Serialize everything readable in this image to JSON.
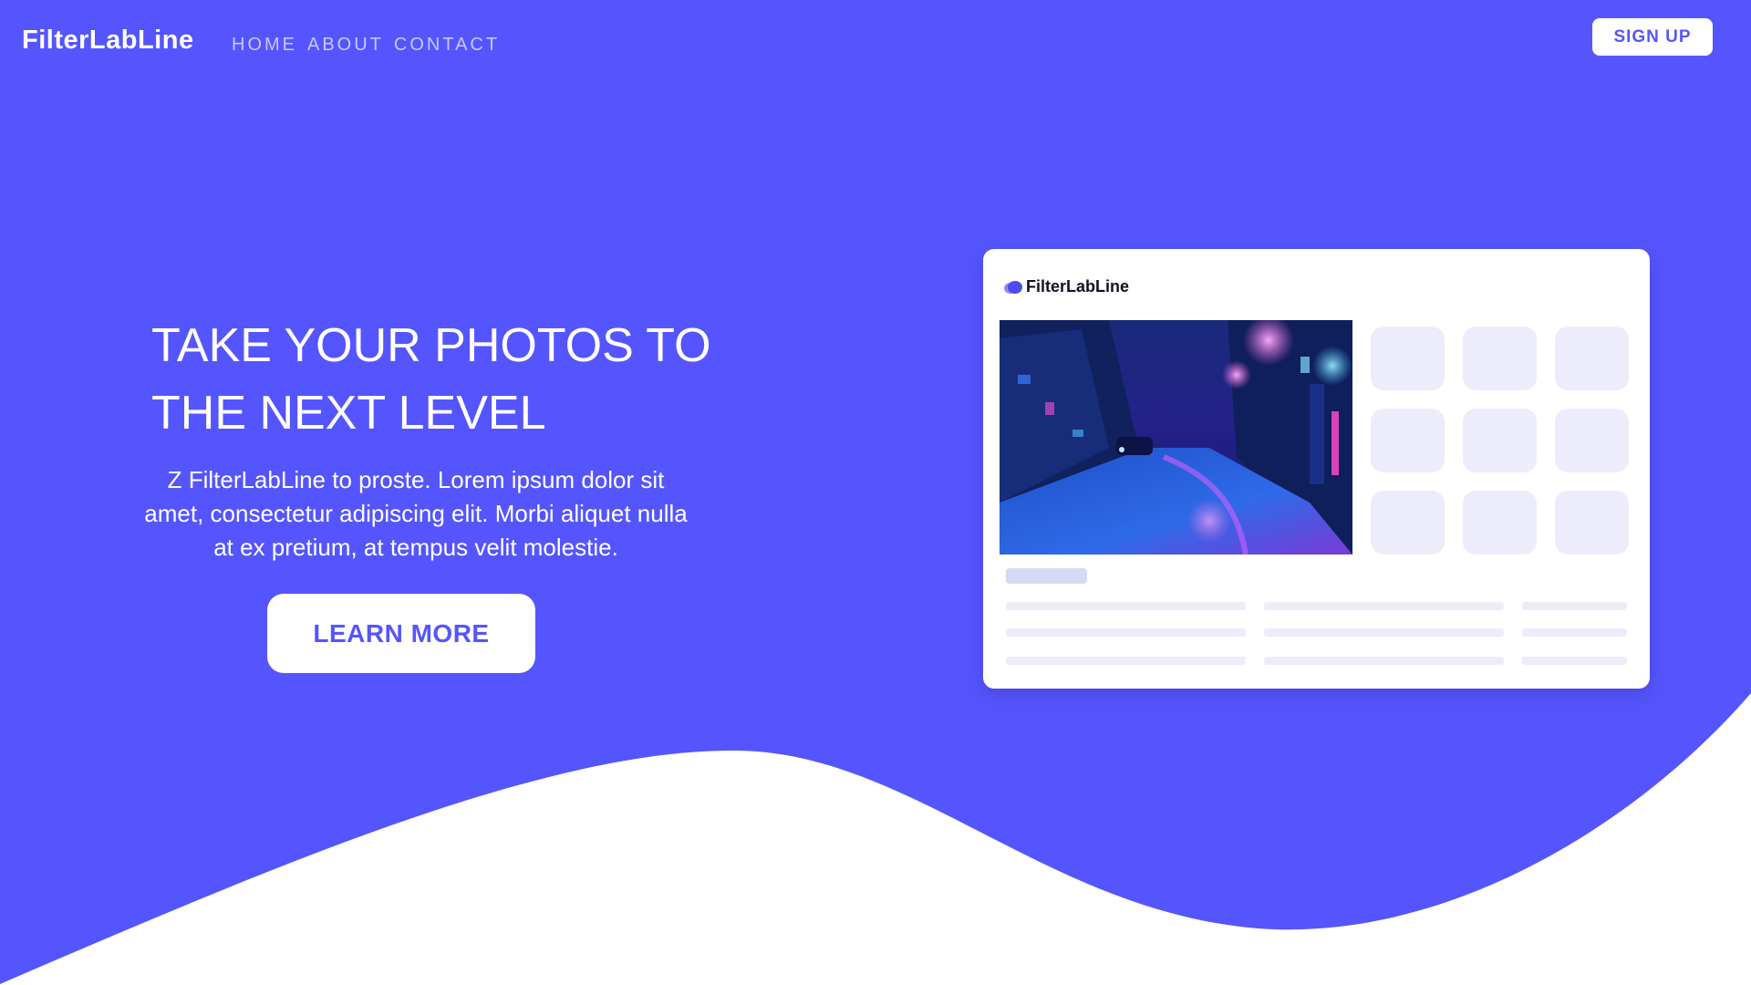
{
  "colors": {
    "brand": "#5555ff",
    "white": "#ffffff",
    "nav_text": "#c7c7ff",
    "skeleton": "#ececfb",
    "skeleton_accent": "#d8d8f7"
  },
  "header": {
    "brand": "FilterLabLine",
    "nav": [
      {
        "label": "HOME"
      },
      {
        "label": "ABOUT"
      },
      {
        "label": "CONTACT"
      }
    ],
    "signup_label": "SIGN UP"
  },
  "hero": {
    "title": "TAKE YOUR PHOTOS TO THE NEXT LEVEL",
    "description": "Z FilterLabLine to proste. Lorem ipsum dolor sit amet, consectetur adipiscing elit. Morbi aliquet nulla at ex pretium, at tempus velit molestie.",
    "cta_label": "LEARN MORE"
  },
  "mockup": {
    "brand": "FilterLabLine",
    "logo_icon": "cloud-icon",
    "photo_icon": "night-street-photo"
  }
}
